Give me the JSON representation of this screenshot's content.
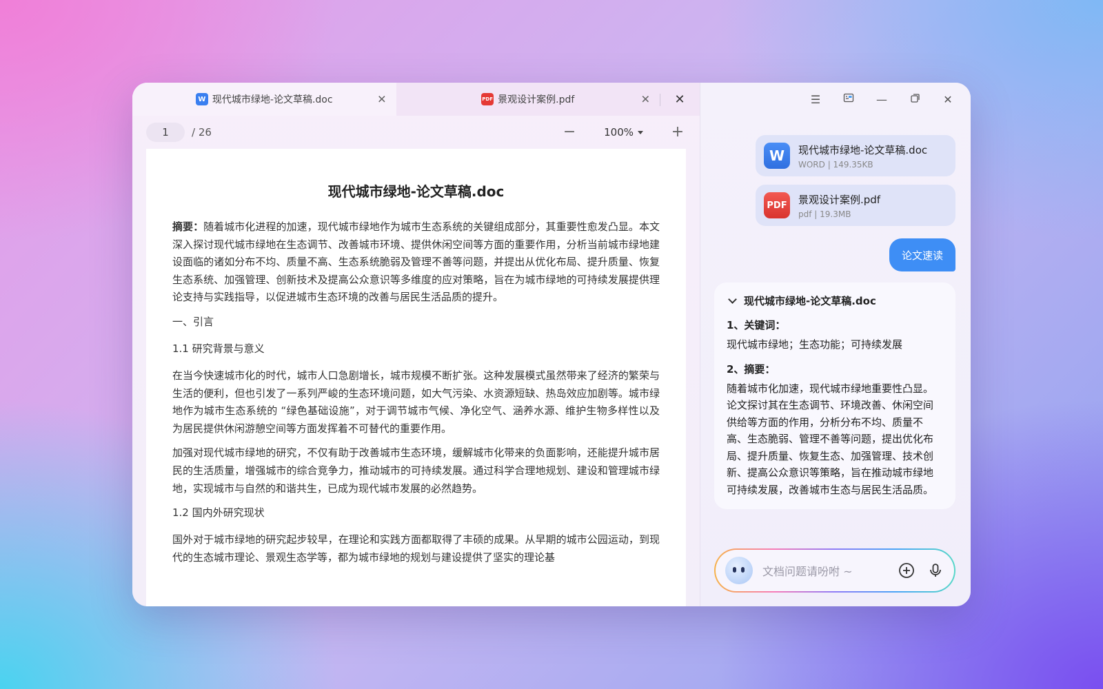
{
  "tabs": [
    {
      "label": "现代城市绿地-论文草稿.doc",
      "icon": "word-file-icon",
      "icon_text": "W"
    },
    {
      "label": "景观设计案例.pdf",
      "icon": "pdf-file-icon",
      "icon_text": "PDF"
    }
  ],
  "toolbar": {
    "page_current": "1",
    "page_total": "/ 26",
    "zoom": "100%"
  },
  "document": {
    "title": "现代城市绿地-论文草稿.doc",
    "abstract_label": "摘要：",
    "abstract_text": "随着城市化进程的加速，现代城市绿地作为城市生态系统的关键组成部分，其重要性愈发凸显。本文深入探讨现代城市绿地在生态调节、改善城市环境、提供休闲空间等方面的重要作用，分析当前城市绿地建设面临的诸如分布不均、质量不高、生态系统脆弱及管理不善等问题，并提出从优化布局、提升质量、恢复生态系统、加强管理、创新技术及提高公众意识等多维度的应对策略，旨在为城市绿地的可持续发展提供理论支持与实践指导，以促进城市生态环境的改善与居民生活品质的提升。",
    "h1": "一、引言",
    "h11": "1.1 研究背景与意义",
    "p1": "在当今快速城市化的时代，城市人口急剧增长，城市规模不断扩张。这种发展模式虽然带来了经济的繁荣与生活的便利，但也引发了一系列严峻的生态环境问题，如大气污染、水资源短缺、热岛效应加剧等。城市绿地作为城市生态系统的 “绿色基础设施”，对于调节城市气候、净化空气、涵养水源、维护生物多样性以及为居民提供休闲游憩空间等方面发挥着不可替代的重要作用。",
    "p2": "加强对现代城市绿地的研究，不仅有助于改善城市生态环境，缓解城市化带来的负面影响，还能提升城市居民的生活质量，增强城市的综合竞争力，推动城市的可持续发展。通过科学合理地规划、建设和管理城市绿地，实现城市与自然的和谐共生，已成为现代城市发展的必然趋势。",
    "h12": "1.2 国内外研究现状",
    "p3": "国外对于城市绿地的研究起步较早，在理论和实践方面都取得了丰硕的成果。从早期的城市公园运动，到现代的生态城市理论、景观生态学等，都为城市绿地的规划与建设提供了坚实的理论基"
  },
  "chat": {
    "files": [
      {
        "name": "现代城市绿地-论文草稿.doc",
        "meta": "WORD  |  149.35KB",
        "icon_text": "W"
      },
      {
        "name": "景观设计案例.pdf",
        "meta": "pdf  |  19.3MB",
        "icon_text": "PDF"
      }
    ],
    "user_message": "论文速读",
    "answer": {
      "title": "现代城市绿地-论文草稿.doc",
      "keywords_label": "1、关键词：",
      "keywords": "现代城市绿地；生态功能；可持续发展",
      "summary_label": "2、摘要：",
      "summary": "随着城市化加速，现代城市绿地重要性凸显。论文探讨其在生态调节、环境改善、休闲空间供给等方面的作用，分析分布不均、质量不高、生态脆弱、管理不善等问题，提出优化布局、提升质量、恢复生态、加强管理、技术创新、提高公众意识等策略，旨在推动城市绿地可持续发展，改善城市生态与居民生活品质。"
    },
    "input_placeholder": "文档问题请吩咐 ~"
  },
  "colors": {
    "accent": "#3e8ef5",
    "word": "#3a7ff0",
    "pdf": "#e53935"
  }
}
